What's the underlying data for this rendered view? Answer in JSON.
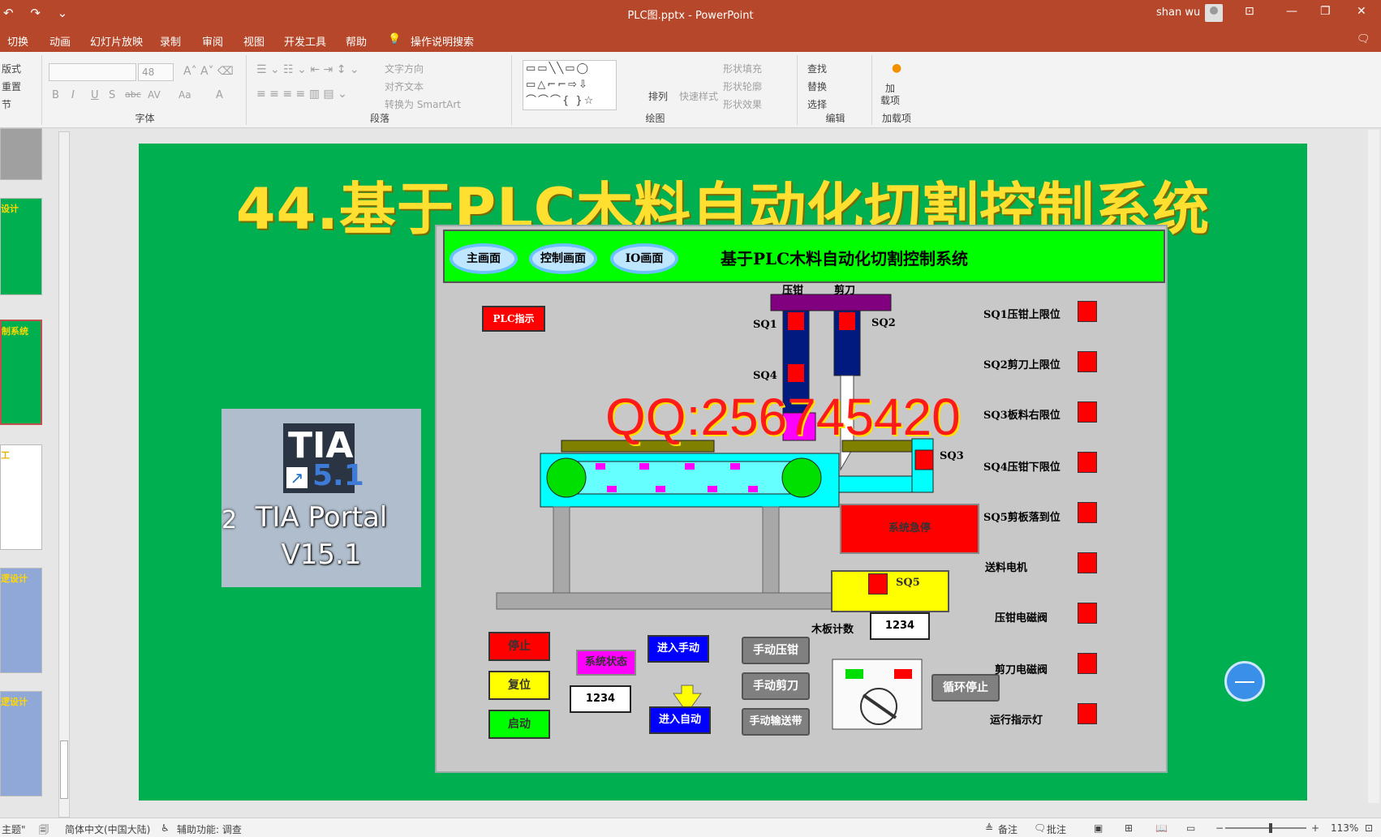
{
  "window": {
    "title": "PLC图.pptx - PowerPoint",
    "user": "shan wu",
    "qat_icons": [
      "undo-icon",
      "redo-icon",
      "customize-icon"
    ]
  },
  "tabs": [
    "切换",
    "动画",
    "幻灯片放映",
    "录制",
    "审阅",
    "视图",
    "开发工具",
    "帮助",
    "操作说明搜索"
  ],
  "ribbon": {
    "slides_group": [
      "版式",
      "重置",
      "节"
    ],
    "font": {
      "name": "",
      "size": "48",
      "label": "字体"
    },
    "font_buttons": [
      "B",
      "I",
      "U",
      "S",
      "abc",
      "AV",
      "Aa",
      "A"
    ],
    "paragraph": {
      "label": "段落",
      "text_direction": "文字方向",
      "align_text": "对齐文本",
      "smartart": "转换为 SmartArt"
    },
    "drawing": {
      "label": "绘图",
      "arrange": "排列",
      "quick_styles": "快速样式",
      "shape_fill": "形状填充",
      "shape_outline": "形状轮廓",
      "shape_effects": "形状效果"
    },
    "editing": {
      "label": "编辑",
      "find": "查找",
      "replace": "替换",
      "select": "选择"
    },
    "addins": {
      "label": "加载项",
      "button": "加\n载项"
    }
  },
  "thumbnails": [
    {
      "label": ""
    },
    {
      "label": "设计"
    },
    {
      "label": "制系统"
    },
    {
      "label": "工"
    },
    {
      "label": "逻设计"
    },
    {
      "label": "逻设计"
    }
  ],
  "slide": {
    "title": "44.基于PLC木料自动化切割控制系统",
    "tia": {
      "name_line1": "TIA Portal",
      "name_line2": "V15.1",
      "logo_t1": "TIA",
      "logo_t2": "5.1",
      "edge_char": "2"
    },
    "watermark": "QQ:256745420",
    "hmi": {
      "nav": [
        "主画面",
        "控制画面",
        "IO画面"
      ],
      "title": "基于PLC木料自动化切割控制系统",
      "plc_indicator": "PLC指示",
      "press_label": "压钳",
      "cutter_label": "剪刀",
      "sensors": {
        "sq1": "SQ1",
        "sq2": "SQ2",
        "sq3": "SQ3",
        "sq4": "SQ4",
        "sq5": "SQ5"
      },
      "emergency": "系统急停",
      "board_count_label": "木板计数",
      "board_count_value": "1234",
      "status_label": "系统状态",
      "status_value": "1234",
      "buttons": {
        "stop": "停止",
        "reset": "复位",
        "start": "启动",
        "manual": "进入手动",
        "auto": "进入自动",
        "manual_press": "手动压钳",
        "manual_cut": "手动剪刀",
        "manual_conveyor": "手动输送带",
        "cycle_stop": "循环停止"
      },
      "io_list": [
        "SQ1压钳上限位",
        "SQ2剪刀上限位",
        "SQ3板料右限位",
        "SQ4压钳下限位",
        "SQ5剪板落到位",
        "送料电机",
        "压钳电磁阀",
        "剪刀电磁阀",
        "运行指示灯"
      ]
    }
  },
  "statusbar": {
    "theme": "主题\"",
    "language": "简体中文(中国大陆)",
    "accessibility": "辅助功能: 调查",
    "notes": "备注",
    "comments": "批注",
    "zoom": "113%"
  },
  "colors": {
    "accent": "#b7472a",
    "slide_bg": "#00b050",
    "title_yellow": "#ffe030",
    "hmi_green": "#00ff00",
    "indicator_red": "#ff0000"
  }
}
